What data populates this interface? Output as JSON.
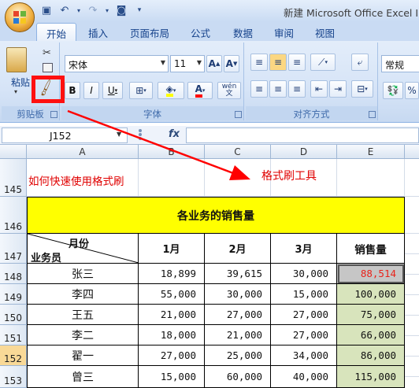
{
  "window_title": "新建 Microsoft Office Excel I",
  "tabs": [
    "开始",
    "插入",
    "页面布局",
    "公式",
    "数据",
    "审阅",
    "视图"
  ],
  "active_tab": "开始",
  "ribbon": {
    "paste_label": "粘贴",
    "font_name": "宋体",
    "font_size": "11",
    "style_label": "常规",
    "groups": {
      "clipboard": "剪贴板",
      "font": "字体",
      "alignment": "对齐方式"
    },
    "wen_label": "wén"
  },
  "name_box": "J152",
  "fx_label": "fx",
  "columns": [
    "A",
    "B",
    "C",
    "D",
    "E"
  ],
  "rows": [
    "145",
    "146",
    "147",
    "148",
    "149",
    "150",
    "151",
    "152",
    "153"
  ],
  "annotations": {
    "cell_a145": "如何快速使用格式刷",
    "callout": "格式刷工具"
  },
  "table": {
    "title": "各业务的销售量",
    "header_month": "月份",
    "header_person": "业务员",
    "months": [
      "1月",
      "2月",
      "3月"
    ],
    "total_header": "销售量",
    "records": [
      {
        "name": "张三",
        "m1": "18,899",
        "m2": "39,615",
        "m3": "30,000",
        "total": "88,514"
      },
      {
        "name": "李四",
        "m1": "55,000",
        "m2": "30,000",
        "m3": "15,000",
        "total": "100,000"
      },
      {
        "name": "王五",
        "m1": "21,000",
        "m2": "27,000",
        "m3": "27,000",
        "total": "75,000"
      },
      {
        "name": "李二",
        "m1": "18,000",
        "m2": "21,000",
        "m3": "27,000",
        "total": "66,000"
      },
      {
        "name": "翟一",
        "m1": "27,000",
        "m2": "25,000",
        "m3": "34,000",
        "total": "86,000"
      },
      {
        "name": "曾三",
        "m1": "15,000",
        "m2": "60,000",
        "m3": "40,000",
        "total": "115,000"
      }
    ]
  },
  "colors": {
    "title_fill": "#ffff00",
    "total_fill": "#d8e4bc",
    "highlight_text": "#e8221a",
    "annotation": "#e00000",
    "selected_row": "#f9d997"
  }
}
